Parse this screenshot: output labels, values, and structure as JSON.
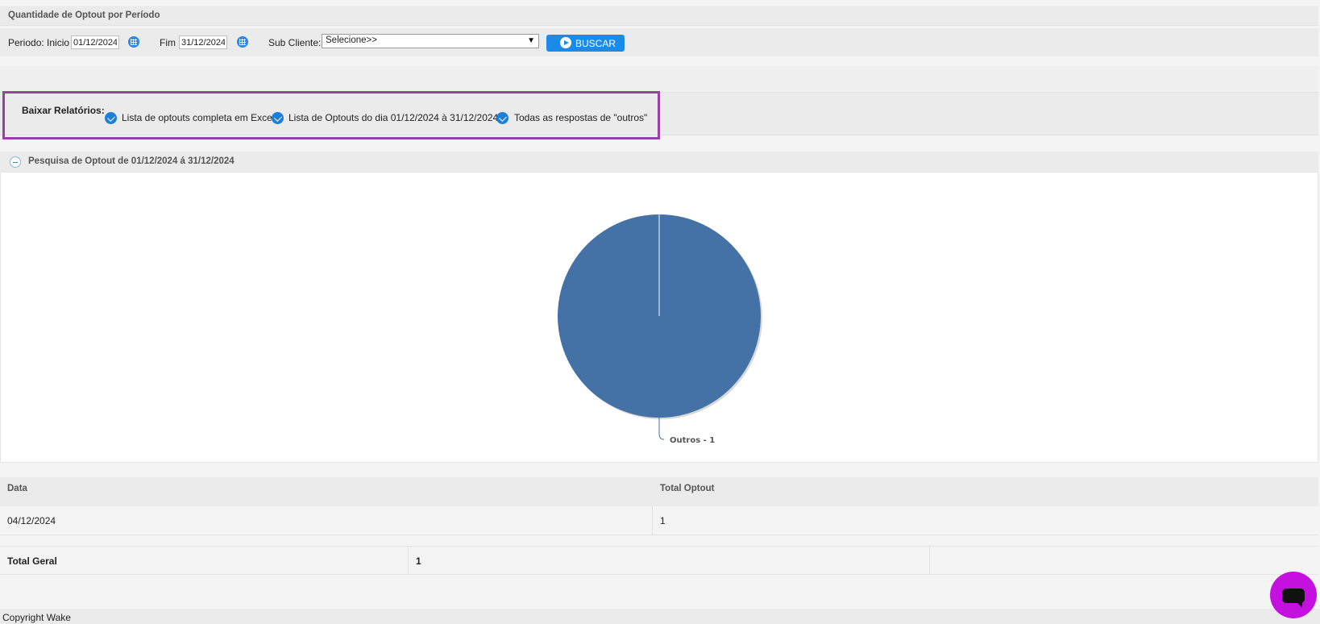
{
  "page": {
    "title": "Quantidade de Optout por Período"
  },
  "filters": {
    "periodo_label": "Periodo: Inicio",
    "inicio_value": "01/12/2024",
    "fim_label": "Fim",
    "fim_value": "31/12/2024",
    "subcliente_label": "Sub Cliente:",
    "subcliente_selected": "Selecione>>",
    "buscar_label": "BUSCAR"
  },
  "reports": {
    "label": "Baixar Relatórios:",
    "links": [
      "Lista de optouts completa em Excel",
      "Lista de Optouts do dia 01/12/2024 à 31/12/2024",
      "Todas as respostas de \"outros\""
    ]
  },
  "panel": {
    "title": "Pesquisa de Optout de 01/12/2024 á 31/12/2024"
  },
  "chart_data": {
    "type": "pie",
    "categories": [
      "Outros"
    ],
    "values": [
      1
    ],
    "data_labels": [
      "Outros - 1"
    ],
    "colors": [
      "#4472a6"
    ]
  },
  "table": {
    "headers": [
      "Data",
      "Total Optout"
    ],
    "rows": [
      [
        "04/12/2024",
        "1"
      ]
    ]
  },
  "totals": {
    "label": "Total Geral",
    "value": "1"
  },
  "footer": {
    "text": "Copyright Wake"
  },
  "colors": {
    "accent": "#1a8be8",
    "highlight": "#9b3fa6",
    "chat": "#c511e0"
  }
}
